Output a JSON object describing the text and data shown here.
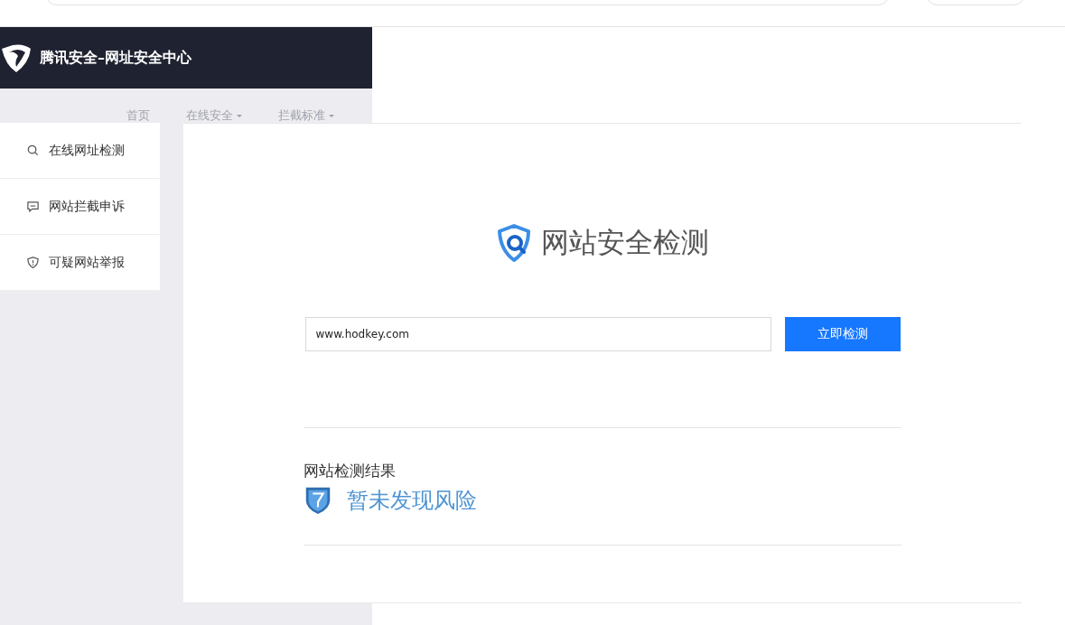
{
  "header": {
    "title": "腾讯安全–网址安全中心"
  },
  "nav": [
    {
      "label": "首页",
      "has_caret": false
    },
    {
      "label": "在线安全",
      "has_caret": true
    },
    {
      "label": "拦截标准",
      "has_caret": true
    }
  ],
  "sidebar": {
    "items": [
      {
        "label": "在线网址检测",
        "kind": "search"
      },
      {
        "label": "网站拦截申诉",
        "kind": "chat"
      },
      {
        "label": "可疑网站举报",
        "kind": "shield"
      }
    ]
  },
  "checker": {
    "title": "网站安全检测",
    "url_field": {
      "value": "www.hodkey.com"
    },
    "submit": "立即检测"
  },
  "result": {
    "heading": "网站检测结果",
    "status": "暂未发现风险",
    "safe": true
  }
}
